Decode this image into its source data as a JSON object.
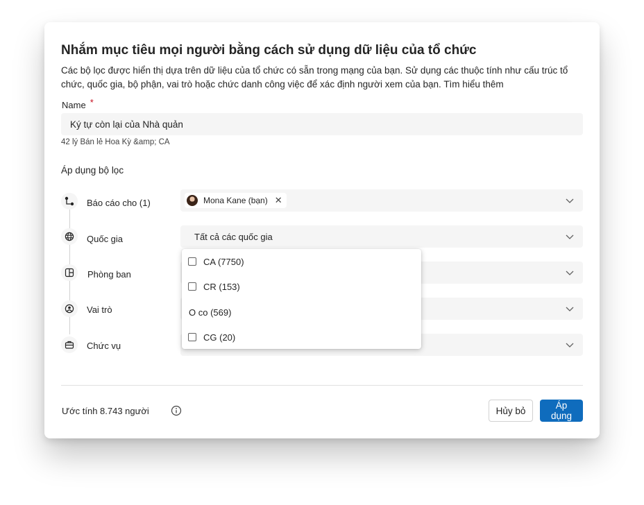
{
  "dialog": {
    "title": "Nhắm mục tiêu mọi người bằng cách sử dụng dữ liệu của tổ chức",
    "description": "Các bộ lọc được hiển thị dựa trên dữ liệu của tổ chức có sẵn trong mạng của bạn. Sử dụng các thuộc tính như cấu trúc tổ chức, quốc gia, bộ phận, vai trò hoặc chức danh công việc để xác định người xem của bạn.",
    "learn_more": "Tìm hiểu thêm"
  },
  "name_field": {
    "label": "Name",
    "required_marker": "*",
    "value": "Ký tự còn lại của Nhà quản",
    "hint": "42 lý Bán lẻ Hoa Kỳ &amp; CA"
  },
  "filters": {
    "heading": "Áp dụng bộ lọc",
    "items": [
      {
        "label": "Báo cáo cho (1)",
        "icon": "org-chart-icon"
      },
      {
        "label": "Quốc gia",
        "icon": "globe-icon",
        "value": "Tất cả các quốc gia"
      },
      {
        "label": "Phòng ban",
        "icon": "building-icon"
      },
      {
        "label": "Vai trò",
        "icon": "person-circle-icon"
      },
      {
        "label": "Chức vụ",
        "icon": "briefcase-icon"
      }
    ],
    "reports_chip": {
      "name": "Mona Kane (bạn)",
      "remove": "✕"
    }
  },
  "country_dropdown": {
    "options": [
      {
        "label": "CA (7750)",
        "checkbox": true
      },
      {
        "label": "CR (153)",
        "checkbox": true
      },
      {
        "label": "O co (569)",
        "checkbox": false
      },
      {
        "label": "CG (20)",
        "checkbox": true
      }
    ]
  },
  "footer": {
    "estimate": "Ước tính 8.743 người",
    "info_icon": "info-icon",
    "cancel_label": "Hủy bỏ",
    "apply_label": "Áp dụng"
  },
  "colors": {
    "primary": "#0f6cbd",
    "required": "#c50f1f",
    "field_bg": "#f5f5f5"
  }
}
